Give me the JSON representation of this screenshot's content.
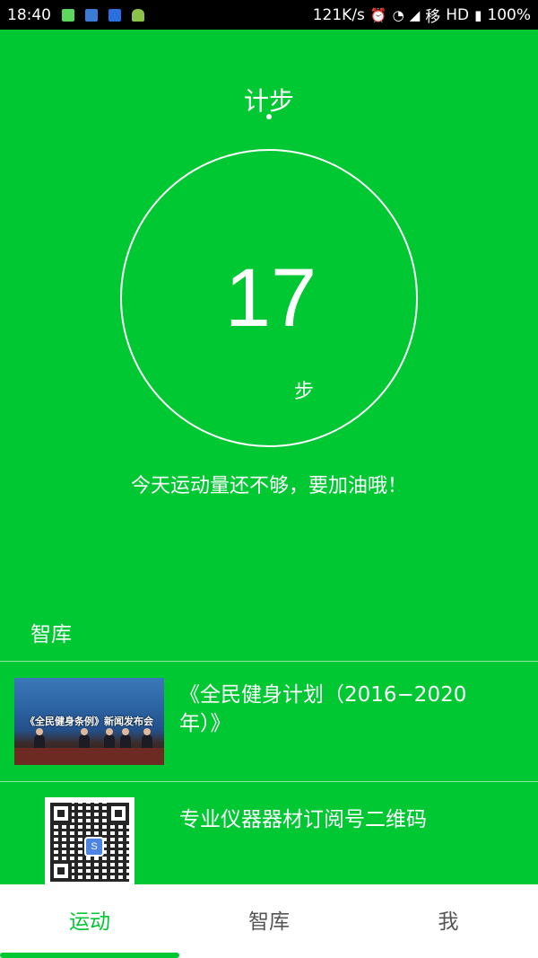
{
  "status_bar": {
    "time": "18:40",
    "net_speed": "121K/s",
    "carrier": "移",
    "network_type": "HD",
    "battery": "100%"
  },
  "header": {
    "title": "计步"
  },
  "pedometer": {
    "steps": "17",
    "unit": "步",
    "message": "今天运动量还不够，要加油哦！"
  },
  "library": {
    "section_title": "智库",
    "articles": [
      {
        "title": "《全民健身计划（2016−2020年）》",
        "image_caption": "《全民健身条例》新闻发布会",
        "image_icon": "press-conference-photo"
      },
      {
        "title": "专业仪器器材订阅号二维码",
        "image_icon": "qr-code"
      }
    ]
  },
  "tabs": [
    {
      "label": "运动",
      "active": true
    },
    {
      "label": "智库",
      "active": false
    },
    {
      "label": "我",
      "active": false
    }
  ],
  "colors": {
    "primary_green": "#00c832",
    "white": "#ffffff"
  }
}
